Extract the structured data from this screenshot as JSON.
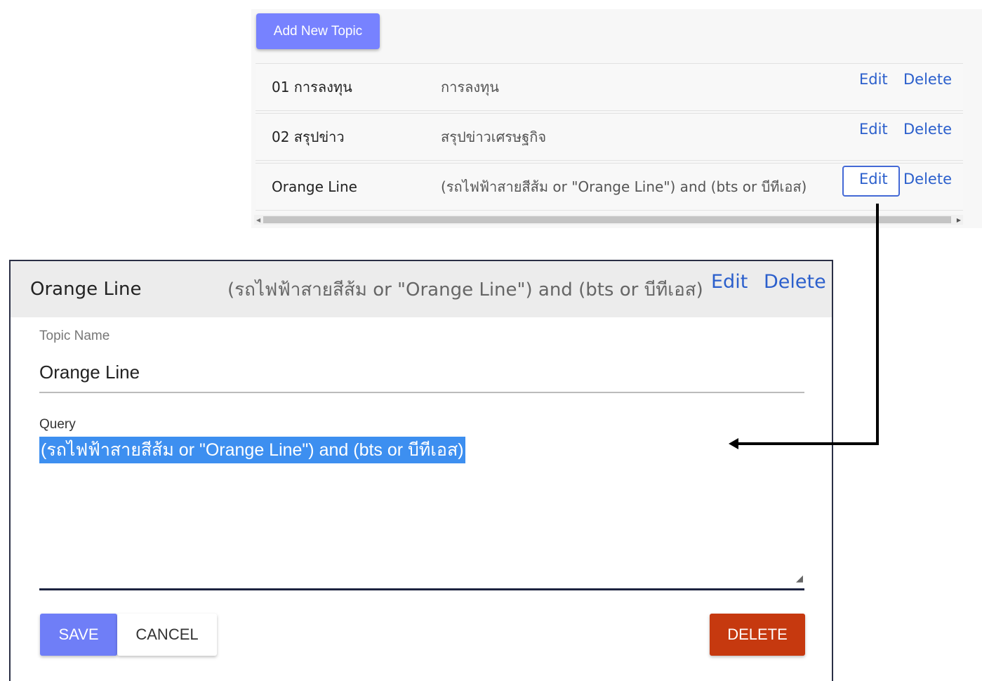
{
  "toolbar": {
    "add_label": "Add New Topic"
  },
  "topics": [
    {
      "name": "01 การลงทุน",
      "query": "การลงทุน",
      "edit": "Edit",
      "delete": "Delete"
    },
    {
      "name": "02 สรุปข่าว",
      "query": "สรุปข่าวเศรษฐกิจ",
      "edit": "Edit",
      "delete": "Delete"
    },
    {
      "name": "Orange Line",
      "query": "(รถไฟฟ้าสายสีส้ม or \"Orange Line\") and (bts or บีทีเอส)",
      "edit": "Edit",
      "delete": "Delete"
    }
  ],
  "dialog": {
    "header": {
      "name": "Orange Line",
      "query": "(รถไฟฟ้าสายสีส้ม or \"Orange Line\") and (bts or บีทีเอส)",
      "edit": "Edit",
      "delete": "Delete"
    },
    "topic_name_label": "Topic Name",
    "topic_name_value": "Orange Line",
    "query_label": "Query",
    "query_value": "(รถไฟฟ้าสายสีส้ม or \"Orange Line\") and (bts or บีทีเอส)",
    "save_label": "SAVE",
    "cancel_label": "CANCEL",
    "delete_label": "DELETE"
  },
  "colors": {
    "primary": "#7782ff",
    "link": "#2b5fcc",
    "danger": "#c6390f",
    "selection": "#3d8ff0"
  }
}
